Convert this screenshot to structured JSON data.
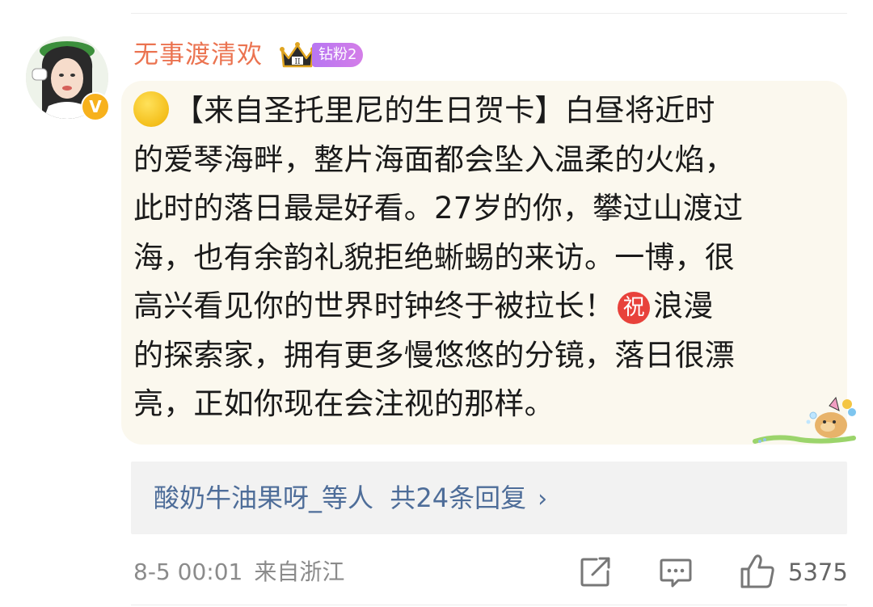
{
  "comment": {
    "username": "无事渡清欢",
    "fan_badge": "钻粉2",
    "text_lines": [
      "【来自圣托里尼的生日贺卡】白昼将近时",
      "的爱琴海畔，整片海面都会坠入温柔的火焰，",
      "此时的落日最是好看。27岁的你，攀过山渡过",
      "海，也有余韵礼貌拒绝蜥蜴的来访。一博，很",
      "高兴看见你的世界时钟终于被拉长！",
      "浪漫",
      "的探索家，拥有更多慢悠悠的分镜，落日很漂",
      "亮，正如你现在会注视的那样。"
    ],
    "emoji_zhu": "祝",
    "replies_summary": "酸奶牛油果呀_等人  共24条回复",
    "reply_chevron": "›",
    "timestamp": "8-5 00:01",
    "location": "来自浙江",
    "like_count": "5375"
  },
  "avatar": {
    "badge_text": "V"
  },
  "icons": {
    "crown": "crown-icon",
    "share": "share-icon",
    "comment": "comment-icon",
    "like": "thumbs-up-icon",
    "verified": "verified-badge-icon",
    "yellow_circle": "yellow-circle-emoji",
    "zhu": "zhu-emoji"
  },
  "colors": {
    "username": "#eb7350",
    "link": "#4e6d99",
    "bubble_bg": "#fbf8ee",
    "badge_start": "#b776f2",
    "badge_end": "#d47ee8"
  }
}
